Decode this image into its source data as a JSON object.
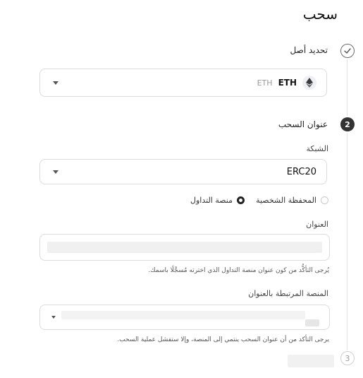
{
  "page": {
    "title": "سحب"
  },
  "steps": [
    {
      "index": "",
      "label": "تحديد أصل",
      "state": "done",
      "icon": "check-icon"
    },
    {
      "index": "2",
      "label": "عنوان السحب",
      "state": "active"
    },
    {
      "index": "3",
      "label": "",
      "state": "pending"
    }
  ],
  "asset": {
    "code": "ETH",
    "name": "ETH",
    "icon": "ethereum-icon"
  },
  "network": {
    "label": "الشبكة",
    "value": "ERC20"
  },
  "destination": {
    "options": [
      {
        "label": "منصة التداول",
        "selected": true
      },
      {
        "label": "المحفظة الشخصية",
        "selected": false
      }
    ]
  },
  "address": {
    "label": "العنوان",
    "hint": "يُرجى التأكُّد من كون عنوان منصة التداول الذي اخترته مُسجَّلًا باسمك."
  },
  "platform": {
    "label": "المنصة المرتبطة بالعنوان",
    "hint": "يرجى التأكد من أن عنوان السحب ينتمي إلى المنصة، وإلا ستفشل عملية السحب."
  },
  "colors": {
    "accent": "#333333",
    "border": "#dcdcdc",
    "muted": "#9a9a9a"
  }
}
